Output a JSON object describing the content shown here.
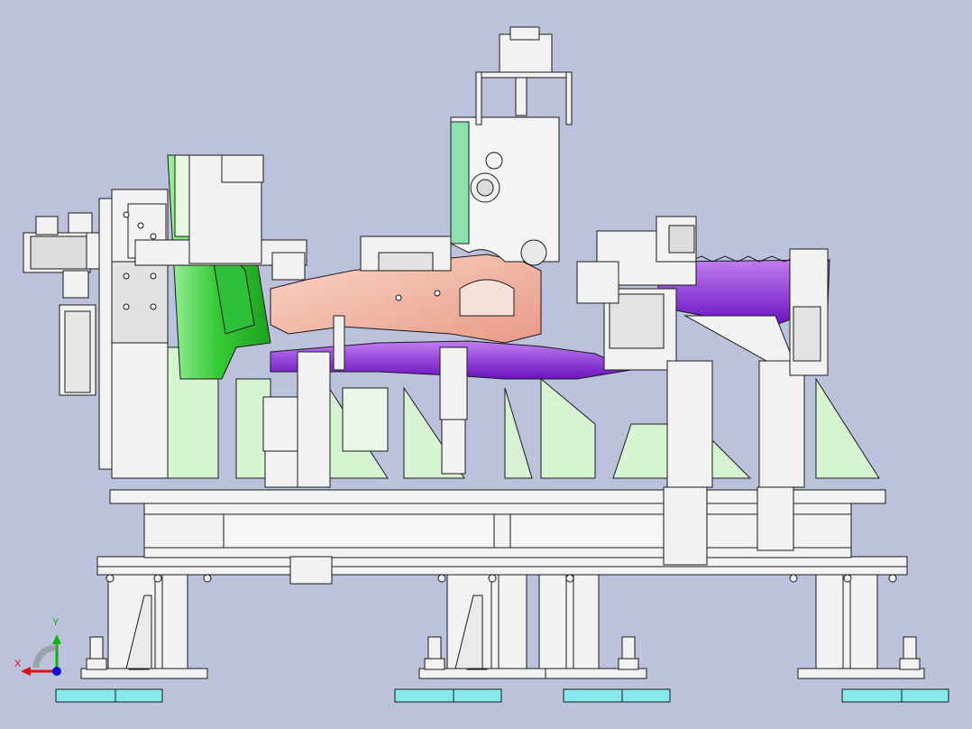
{
  "viewport": {
    "background": "#bcc1dc",
    "model_colors": {
      "frame": "#f2f2f2",
      "outline": "#1a1a1a",
      "support": "#d9f2d4",
      "green_part": "#49d24a",
      "purple_part": "#8b2bd6",
      "salmon_part": "#f3b7a5",
      "cyan_pad": "#7fe6ea"
    }
  },
  "triad": {
    "x_label": "X",
    "y_label": "Y",
    "x_color": "#e01010",
    "y_color": "#10b010",
    "z_color": "#1010d0"
  }
}
